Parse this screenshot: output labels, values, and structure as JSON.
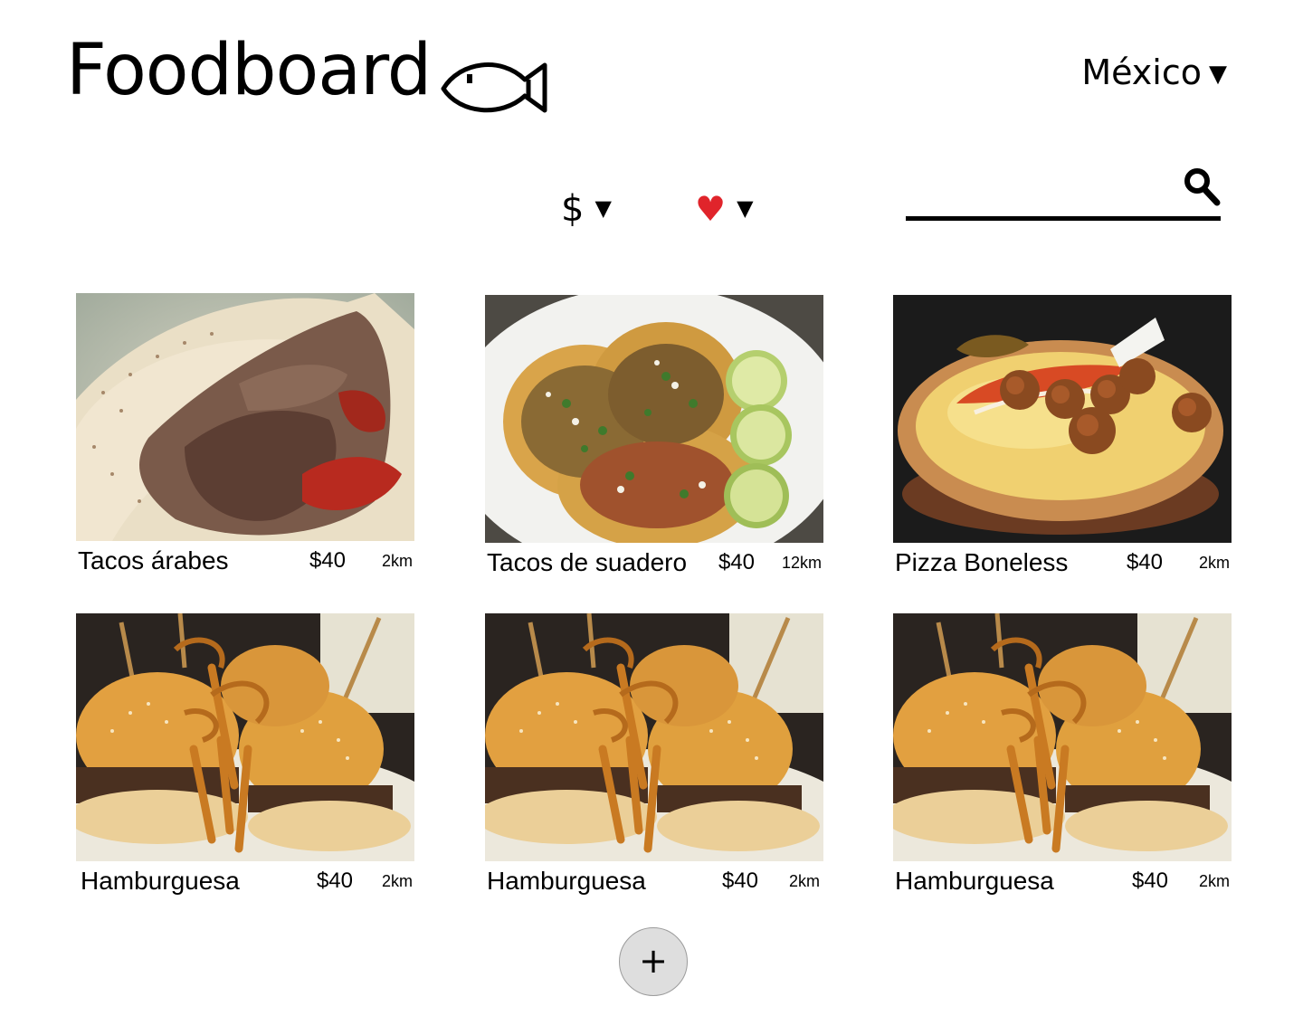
{
  "header": {
    "brand": "Foodboard",
    "logo_icon": "fish-icon",
    "country": "México",
    "country_caret": "▼"
  },
  "filters": {
    "price_label": "$",
    "price_caret": "▼",
    "favorite_label": "♥",
    "favorite_caret": "▼"
  },
  "search": {
    "value": "",
    "placeholder": "",
    "icon": "search-icon"
  },
  "cards": [
    {
      "name": "Tacos árabes",
      "price": "$40",
      "distance": "2km",
      "image": "tacos-arabes"
    },
    {
      "name": "Tacos de suadero",
      "price": "$40",
      "distance": "12km",
      "image": "tacos-suadero"
    },
    {
      "name": "Pizza Boneless",
      "price": "$40",
      "distance": "2km",
      "image": "pizza-boneless"
    },
    {
      "name": "Hamburguesa",
      "price": "$40",
      "distance": "2km",
      "image": "hamburguesa"
    },
    {
      "name": "Hamburguesa",
      "price": "$40",
      "distance": "2km",
      "image": "hamburguesa"
    },
    {
      "name": "Hamburguesa",
      "price": "$40",
      "distance": "2km",
      "image": "hamburguesa"
    }
  ],
  "add_button": {
    "label": "+"
  },
  "colors": {
    "heart": "#e0242b",
    "add_button_bg": "#dedede",
    "text": "#000000"
  }
}
